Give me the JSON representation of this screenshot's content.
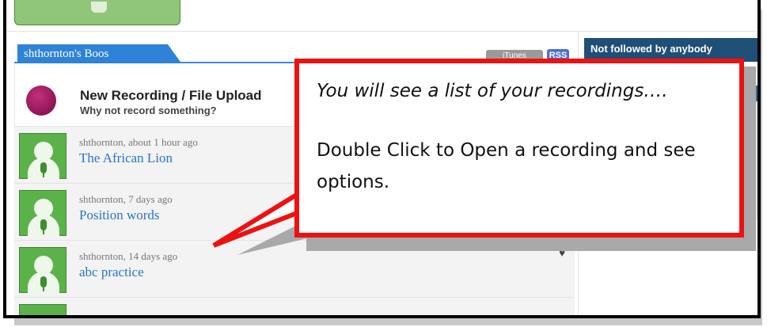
{
  "feed": {
    "tab_label": "shthornton's Boos",
    "itunes_label": "iTunes",
    "rss_label": "RSS",
    "upload": {
      "title": "New Recording / File Upload",
      "subtitle": "Why not record something?"
    },
    "recordings": [
      {
        "meta": "shthornton, about 1 hour ago",
        "title": "The African Lion"
      },
      {
        "meta": "shthornton, 7 days ago",
        "title": "Position words"
      },
      {
        "meta": "shthornton, 14 days ago",
        "title": "abc practice"
      }
    ]
  },
  "sidebar": {
    "header": "Not followed by anybody"
  },
  "callout": {
    "line1": "You will see a list of your recordings….",
    "line2": "Double Click to Open a recording and see options."
  },
  "colors": {
    "accent_blue": "#2e82d8",
    "callout_border": "#ee1111",
    "avatar_green": "#5cb24a",
    "sidebar_header": "#1f4f77"
  }
}
